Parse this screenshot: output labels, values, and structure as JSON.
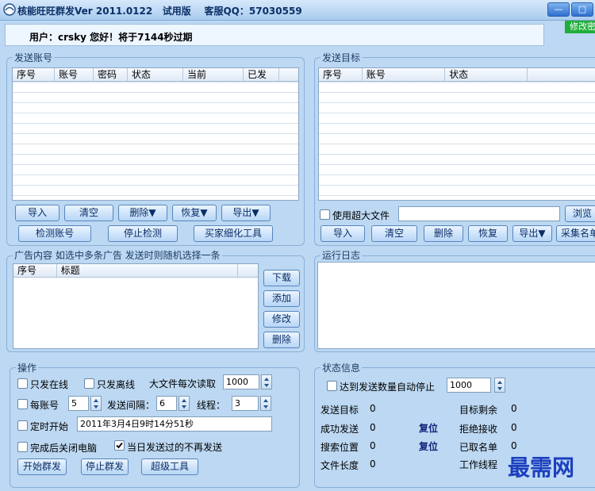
{
  "titlebar": {
    "title": "核能旺旺群发Ver 2011.0122   试用版    客服QQ：57030559",
    "min_glyph": "—",
    "max_glyph": "□"
  },
  "userbar": {
    "text": "用户：crsky 您好！将于7144秒过期",
    "modify_label": "修改密"
  },
  "send_account": {
    "label": "发送账号",
    "columns": [
      "序号",
      "账号",
      "密码",
      "状态",
      "当前",
      "已发"
    ],
    "buttons": [
      "导入",
      "清空",
      "删除▼",
      "恢复▼",
      "导出▼"
    ],
    "buttons2": [
      "检测账号",
      "停止检测",
      "买家细化工具"
    ]
  },
  "send_target": {
    "label": "发送目标",
    "columns": [
      "序号",
      "账号",
      "状态"
    ],
    "use_big_file_label": "使用超大文件",
    "browse_label": "浏览",
    "buttons": [
      "导入",
      "清空",
      "删除",
      "恢复",
      "导出▼",
      "采集名单"
    ]
  },
  "ad": {
    "label": "广告内容   如选中多条广告 发送时则随机选择一条",
    "columns": [
      "序号",
      "标题"
    ],
    "buttons": [
      "下载",
      "添加",
      "修改",
      "删除"
    ]
  },
  "log": {
    "label": "运行日志"
  },
  "ops": {
    "label": "操作",
    "only_online": "只发在线",
    "only_offline": "只发离线",
    "big_file_read": "大文件每次读取",
    "big_file_value": "1000",
    "per_account": "每账号",
    "per_account_value": "5",
    "interval": "发送间隔：",
    "interval_value": "6",
    "threads": "线程：",
    "threads_value": "3",
    "timed_start": "定时开始",
    "timed_value": "2011年3月4日9时14分51秒",
    "shutdown": "完成后关闭电脑",
    "no_repeat": "当日发送过的不再发送",
    "start_btn": "开始群发",
    "stop_btn": "停止群发",
    "super_btn": "超级工具"
  },
  "status": {
    "label": "状态信息",
    "auto_stop": "达到发送数量自动停止",
    "auto_stop_value": "1000",
    "target": "发送目标",
    "target_v": "0",
    "remain": "目标剩余",
    "remain_v": "0",
    "success": "成功发送",
    "success_v": "0",
    "reset1": "复位",
    "reject": "拒绝接收",
    "reject_v": "0",
    "search": "搜索位置",
    "search_v": "0",
    "reset2": "复位",
    "taken": "已取名单",
    "taken_v": "0",
    "filelen": "文件长度",
    "filelen_v": "0",
    "workers": "工作线程",
    "watermark": "最需网"
  },
  "colors": {
    "bg": "#bcd8f2",
    "accent": "#1fae3a",
    "watermark": "#1b3fbf"
  }
}
